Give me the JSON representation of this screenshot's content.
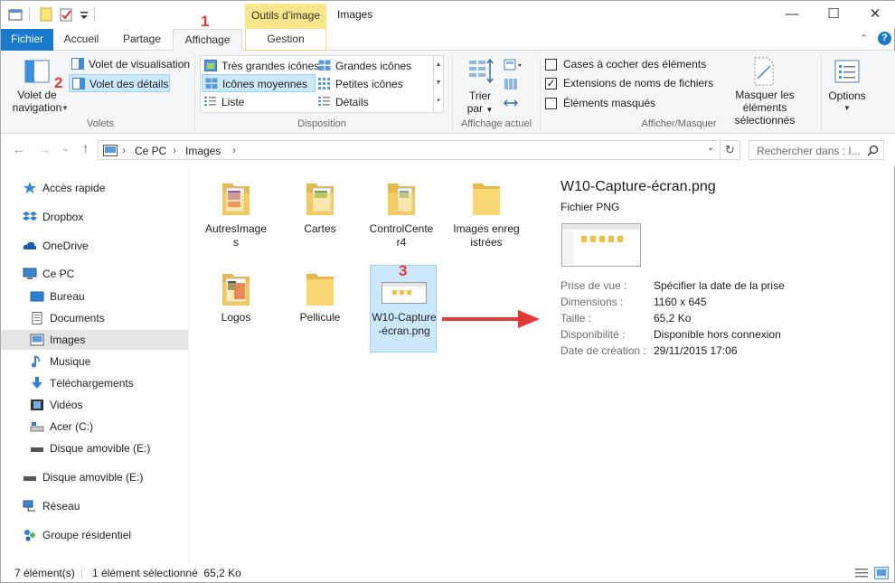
{
  "window": {
    "title": "Images",
    "context_tool": "Outils d’image",
    "controls": [
      "—",
      "☐",
      "✕"
    ]
  },
  "tabs": {
    "fichier": "Fichier",
    "accueil": "Accueil",
    "partage": "Partage",
    "affichage": "Affichage",
    "gestion": "Gestion"
  },
  "ribbon": {
    "volets": {
      "nav_label": "Volet de navigation",
      "visualisation": "Volet de visualisation",
      "details": "Volet des détails",
      "group": "Volets"
    },
    "disposition": {
      "tres_grandes": "Très grandes icônes",
      "grandes": "Grandes icônes",
      "moyennes": "Icônes moyennes",
      "petites": "Petites icônes",
      "liste": "Liste",
      "details": "Détails",
      "group": "Disposition"
    },
    "affichage_actuel": {
      "trier": "Trier",
      "par": "par",
      "group": "Affichage actuel"
    },
    "afficher_masquer": {
      "cases": "Cases à cocher des éléments",
      "extensions": "Extensions de noms de fichiers",
      "masques": "Éléments masqués",
      "masquer_sel": "Masquer les éléments sélectionnés",
      "group": "Afficher/Masquer",
      "extensions_checked": true,
      "cases_checked": false,
      "masques_checked": false
    },
    "options": "Options"
  },
  "annotations": {
    "n1": "1",
    "n2": "2",
    "n3": "3"
  },
  "address": {
    "crumbs": [
      "Ce PC",
      "Images"
    ],
    "search_placeholder": "Rechercher dans : I..."
  },
  "nav": {
    "acces_rapide": "Accès rapide",
    "dropbox": "Dropbox",
    "onedrive": "OneDrive",
    "ce_pc": "Ce PC",
    "bureau": "Bureau",
    "documents": "Documents",
    "images": "Images",
    "musique": "Musique",
    "telechargements": "Téléchargements",
    "videos": "Vidéos",
    "acer": "Acer (C:)",
    "disque_e1": "Disque amovible (E:)",
    "disque_e2": "Disque amovible (E:)",
    "reseau": "Réseau",
    "groupe": "Groupe résidentiel"
  },
  "files": [
    {
      "name": "AutresImages"
    },
    {
      "name": "Cartes"
    },
    {
      "name": "ControlCenter4"
    },
    {
      "name": "Images enregistrées"
    },
    {
      "name": "Logos"
    },
    {
      "name": "Pellicule"
    },
    {
      "name": "W10-Capture-écran.png"
    }
  ],
  "details": {
    "title": "W10-Capture-écran.png",
    "type": "Fichier PNG",
    "rows": [
      {
        "k": "Prise de vue :",
        "v": "Spécifier la date de la prise"
      },
      {
        "k": "Dimensions :",
        "v": "1160 x 645"
      },
      {
        "k": "Taille :",
        "v": "65,2 Ko"
      },
      {
        "k": "Disponibilité :",
        "v": "Disponible hors connexion"
      },
      {
        "k": "Date de création :",
        "v": "29/11/2015 17:06"
      }
    ]
  },
  "status": {
    "count": "7 élément(s)",
    "selection": "1 élément sélectionné  65,2 Ko"
  },
  "colors": {
    "accent": "#1979ca",
    "selection": "#cce8ff",
    "annotation": "#e53935",
    "folder": "#f8d775"
  }
}
